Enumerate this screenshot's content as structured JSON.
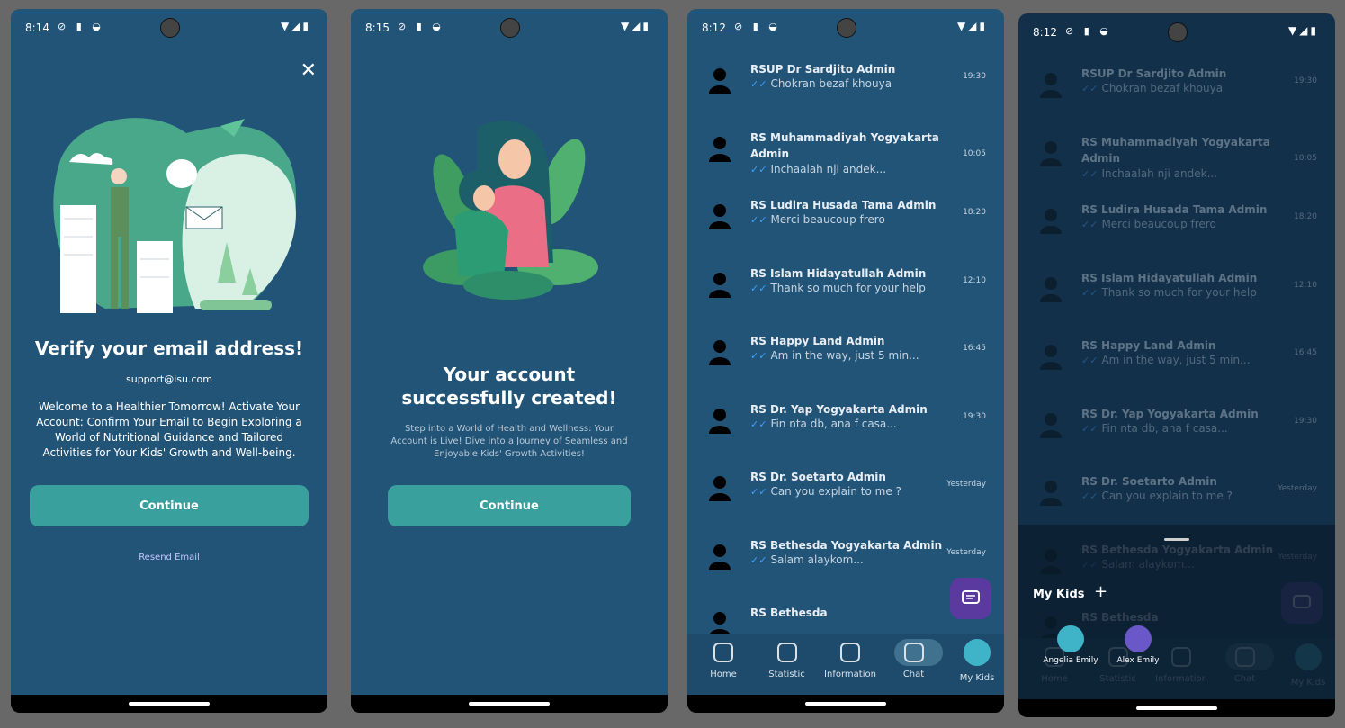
{
  "screens": {
    "verify": {
      "time": "8:14",
      "title": "Verify your email address!",
      "email": "support@isu.com",
      "body": "Welcome to a Healthier Tomorrow! Activate Your Account: Confirm Your Email to Begin Exploring a World of Nutritional Guidance and Tailored Activities for Your Kids' Growth and Well-being.",
      "continue_label": "Continue",
      "resend_label": "Resend Email"
    },
    "created": {
      "time": "8:15",
      "title_line1": "Your account",
      "title_line2": "successfully created!",
      "body": "Step into a World of Health and Wellness: Your Account is Live! Dive into a Journey of Seamless and Enjoyable Kids' Growth Activities!",
      "continue_label": "Continue"
    },
    "chat": {
      "time": "8:12",
      "items": [
        {
          "name": "RSUP Dr Sardjito Admin",
          "msg": "Chokran bezaf khouya",
          "time": "19:30"
        },
        {
          "name": "RS Muhammadiyah Yogyakarta Admin",
          "msg": "Inchaalah nji andek...",
          "time": "10:05"
        },
        {
          "name": "RS Ludira Husada Tama Admin",
          "msg": "Merci beaucoup frero",
          "time": "18:20"
        },
        {
          "name": "RS Islam Hidayatullah Admin",
          "msg": "Thank so much for your help",
          "time": "12:10"
        },
        {
          "name": "RS Happy Land Admin",
          "msg": "Am in the way, just 5 min...",
          "time": "16:45"
        },
        {
          "name": "RS Dr. Yap Yogyakarta Admin",
          "msg": "Fin nta db, ana f casa...",
          "time": "19:30"
        },
        {
          "name": "RS Dr. Soetarto Admin",
          "msg": "Can you explain to me ?",
          "time": "Yesterday"
        },
        {
          "name": "RS Bethesda Yogyakarta Admin",
          "msg": "Salam alaykom...",
          "time": "Yesterday"
        },
        {
          "name": "RS Bethesda",
          "msg": "",
          "time": ""
        }
      ],
      "tabs": [
        "Home",
        "Statistic",
        "Information",
        "Chat",
        "My Kids"
      ]
    },
    "kids_sheet": {
      "time": "8:12",
      "title": "My Kids",
      "plus": "+",
      "kids": [
        "Angelia Emily",
        "Alex Emily"
      ]
    }
  },
  "colors": {
    "background": "#225478",
    "button": "#3aa09e",
    "fab": "#5b3aa0",
    "tick": "#3fa0ff"
  }
}
